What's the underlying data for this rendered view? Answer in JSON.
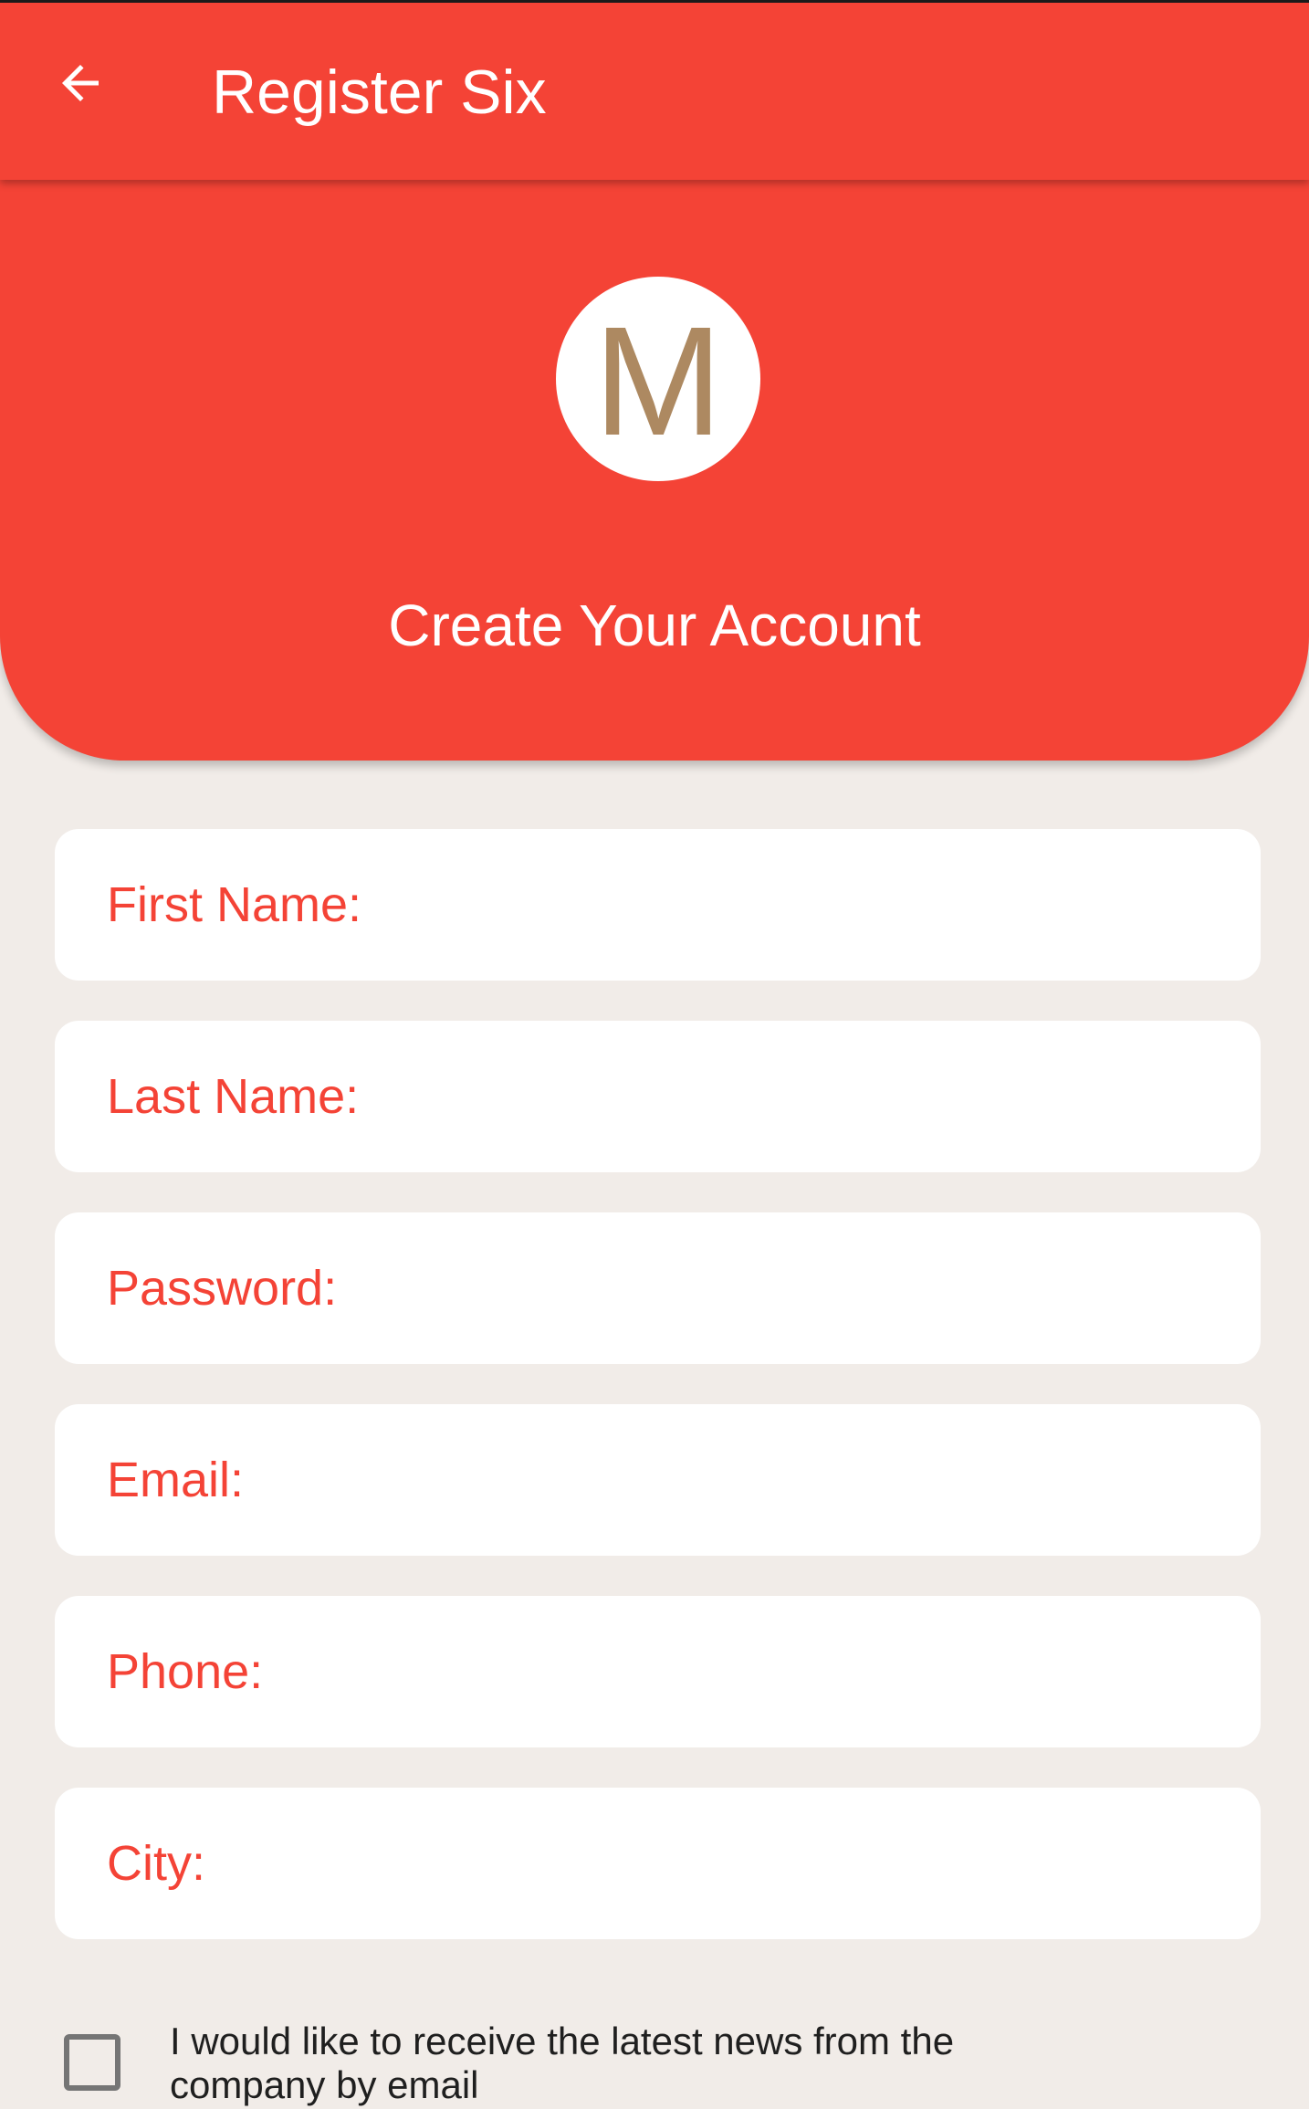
{
  "appbar": {
    "title": "Register Six",
    "back_icon": "arrow-left-icon"
  },
  "header": {
    "avatar_letter": "M",
    "title": "Create Your Account"
  },
  "form": {
    "fields": [
      {
        "label": "First Name:",
        "value": ""
      },
      {
        "label": "Last Name:",
        "value": ""
      },
      {
        "label": "Password:",
        "value": ""
      },
      {
        "label": "Email:",
        "value": ""
      },
      {
        "label": "Phone:",
        "value": ""
      },
      {
        "label": "City:",
        "value": ""
      }
    ],
    "newsletter": {
      "checked": false,
      "label": " I would like to receive the latest news from the company by email"
    }
  },
  "colors": {
    "primary": "#f44336",
    "background": "#f1ece8",
    "avatar_letter": "#ad8961",
    "checkbox_border": "#757575"
  }
}
